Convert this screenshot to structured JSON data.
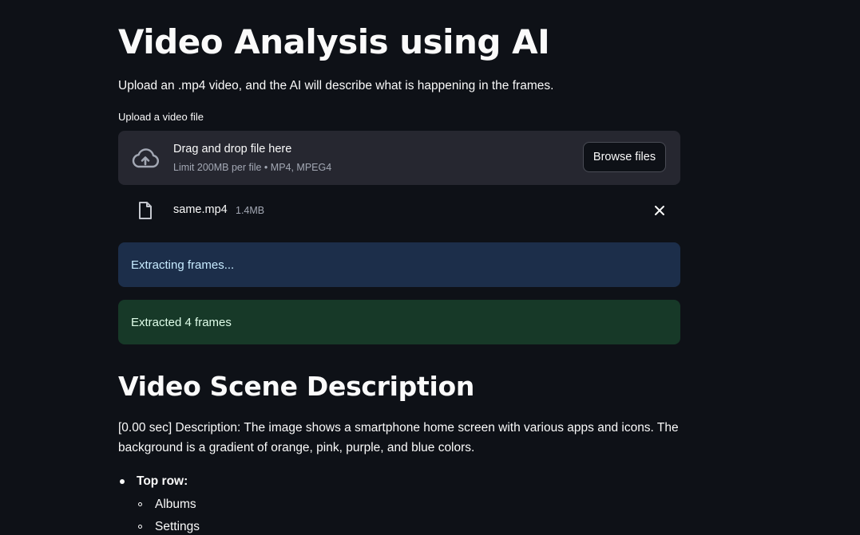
{
  "header": {
    "title": "Video Analysis using AI",
    "subtitle": "Upload an .mp4 video, and the AI will describe what is happening in the frames."
  },
  "uploader": {
    "label": "Upload a video file",
    "drop_text": "Drag and drop file here",
    "limit_text": "Limit 200MB per file • MP4, MPEG4",
    "browse_label": "Browse files",
    "icon": "cloud-upload-icon"
  },
  "file": {
    "name": "same.mp4",
    "size": "1.4MB",
    "icon": "file-icon",
    "remove_icon": "close-icon"
  },
  "alerts": {
    "info": "Extracting frames...",
    "success": "Extracted 4 frames"
  },
  "section": {
    "title": "Video Scene Description",
    "description": "[0.00 sec] Description: The image shows a smartphone home screen with various apps and icons. The background is a gradient of orange, pink, purple, and blue colors.",
    "list": [
      {
        "label": "Top row:",
        "items": [
          "Albums",
          "Settings"
        ]
      }
    ]
  },
  "colors": {
    "background": "#0e1117",
    "surface": "#262730",
    "info_bg": "#1c2e4a",
    "success_bg": "#173928"
  }
}
